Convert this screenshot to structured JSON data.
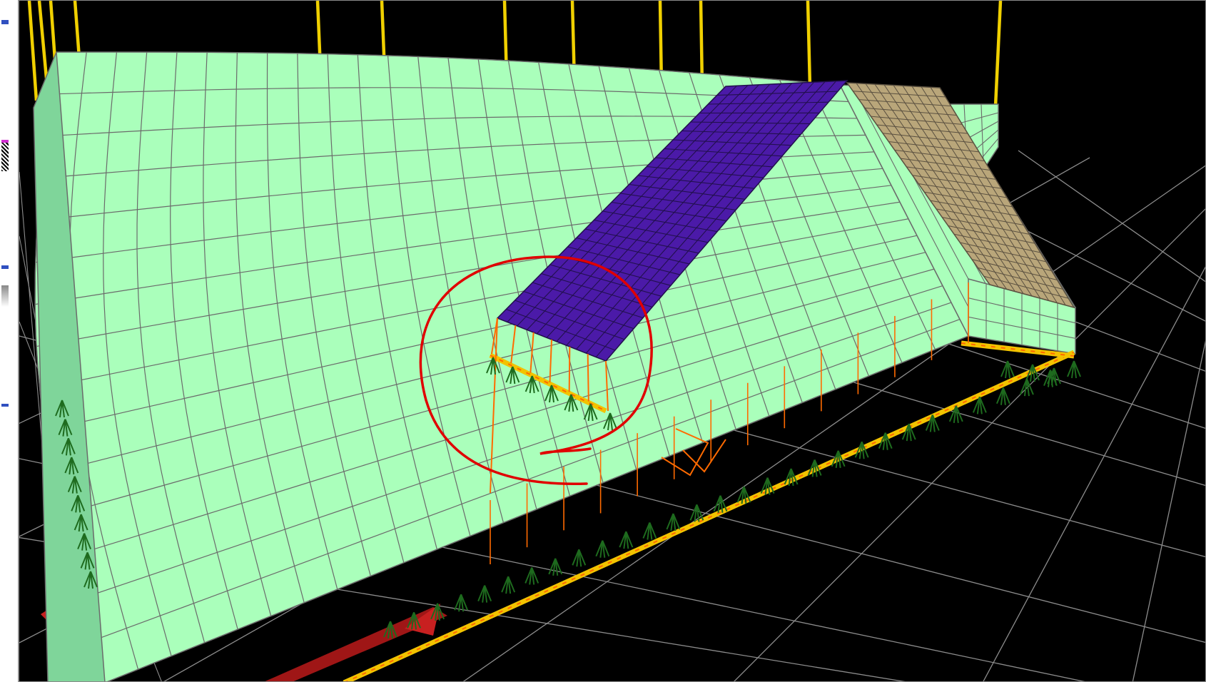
{
  "window": {
    "viewport": "fem-3d-viewport"
  },
  "colors": {
    "background": "#000000",
    "grid": "#8c8c8c",
    "wall": "#aaffbb",
    "wall_mesh": "#6b6b6b",
    "roof_left": "#4b1aa8",
    "roof_right": "#b9a67a",
    "supports": "#1e6b1e",
    "edge_beam": "#f2c300",
    "load_lines": "#ff6a00",
    "vertical_members": "#f0d000",
    "annotation": "#e00000",
    "axis_arrow": "#b01818"
  },
  "icons": {
    "support": "fixed-support-icon",
    "axis": "axis-arrow-icon"
  }
}
